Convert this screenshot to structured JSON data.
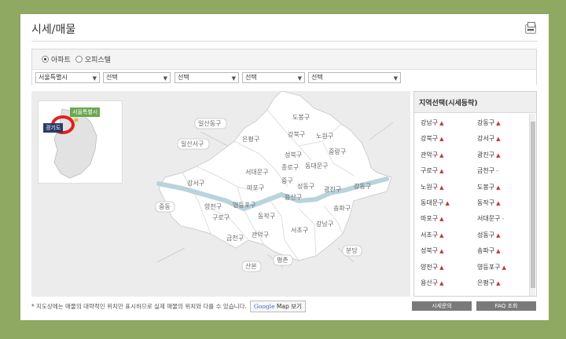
{
  "header": {
    "title": "시세/매물",
    "print_icon": "printer-icon"
  },
  "filters": {
    "types": [
      {
        "label": "아파트",
        "selected": true
      },
      {
        "label": "오피스텔",
        "selected": false
      }
    ],
    "selects": [
      "서울특별시",
      "선택",
      "선택",
      "선택",
      "선택"
    ]
  },
  "minimap": {
    "seoul_label": "서울특별시",
    "gyeonggi_label": "경기도"
  },
  "map": {
    "districts": [
      "도봉구",
      "강북구",
      "노원구",
      "은평구",
      "성북구",
      "중랑구",
      "종로구",
      "동대문구",
      "서대문구",
      "중구",
      "마포구",
      "용산구",
      "성동구",
      "광진구",
      "강동구",
      "강서구",
      "양천구",
      "영등포구",
      "동작구",
      "구로구",
      "금천구",
      "관악구",
      "서초구",
      "강남구",
      "송파구"
    ],
    "outside": [
      "일산동구",
      "일산서구",
      "중동",
      "산본",
      "평촌",
      "분당"
    ]
  },
  "region_panel": {
    "title": "지역선택(시세등락)",
    "left_col": [
      {
        "name": "강남구",
        "mark": "▲"
      },
      {
        "name": "강북구",
        "mark": "▲"
      },
      {
        "name": "관악구",
        "mark": "▲"
      },
      {
        "name": "구로구",
        "mark": "▲"
      },
      {
        "name": "노원구",
        "mark": "▲"
      },
      {
        "name": "동대문구",
        "mark": "▲"
      },
      {
        "name": "마포구",
        "mark": "▲"
      },
      {
        "name": "서초구",
        "mark": "▲"
      },
      {
        "name": "성북구",
        "mark": "▲"
      },
      {
        "name": "양천구",
        "mark": "▲"
      },
      {
        "name": "용산구",
        "mark": "▲"
      }
    ],
    "right_col": [
      {
        "name": "강동구",
        "mark": "▲"
      },
      {
        "name": "강서구",
        "mark": "▲"
      },
      {
        "name": "광진구",
        "mark": "▲"
      },
      {
        "name": "금천구",
        "mark": "-"
      },
      {
        "name": "도봉구",
        "mark": "▲"
      },
      {
        "name": "동작구",
        "mark": "▲"
      },
      {
        "name": "서대문구",
        "mark": "-"
      },
      {
        "name": "성동구",
        "mark": "▲"
      },
      {
        "name": "송파구",
        "mark": "▲"
      },
      {
        "name": "영등포구",
        "mark": "▲"
      },
      {
        "name": "은평구",
        "mark": "▲"
      }
    ]
  },
  "footer": {
    "note": "* 지도상에는 매물의 대략적인 위치만 표시하므로 실제 매물의 위치와 다를 수 있습니다.",
    "map_button_brand": "Google",
    "map_button_text": " Map 보기",
    "inquiry_button": "시세문의",
    "faq_button": "FAQ 조회"
  }
}
